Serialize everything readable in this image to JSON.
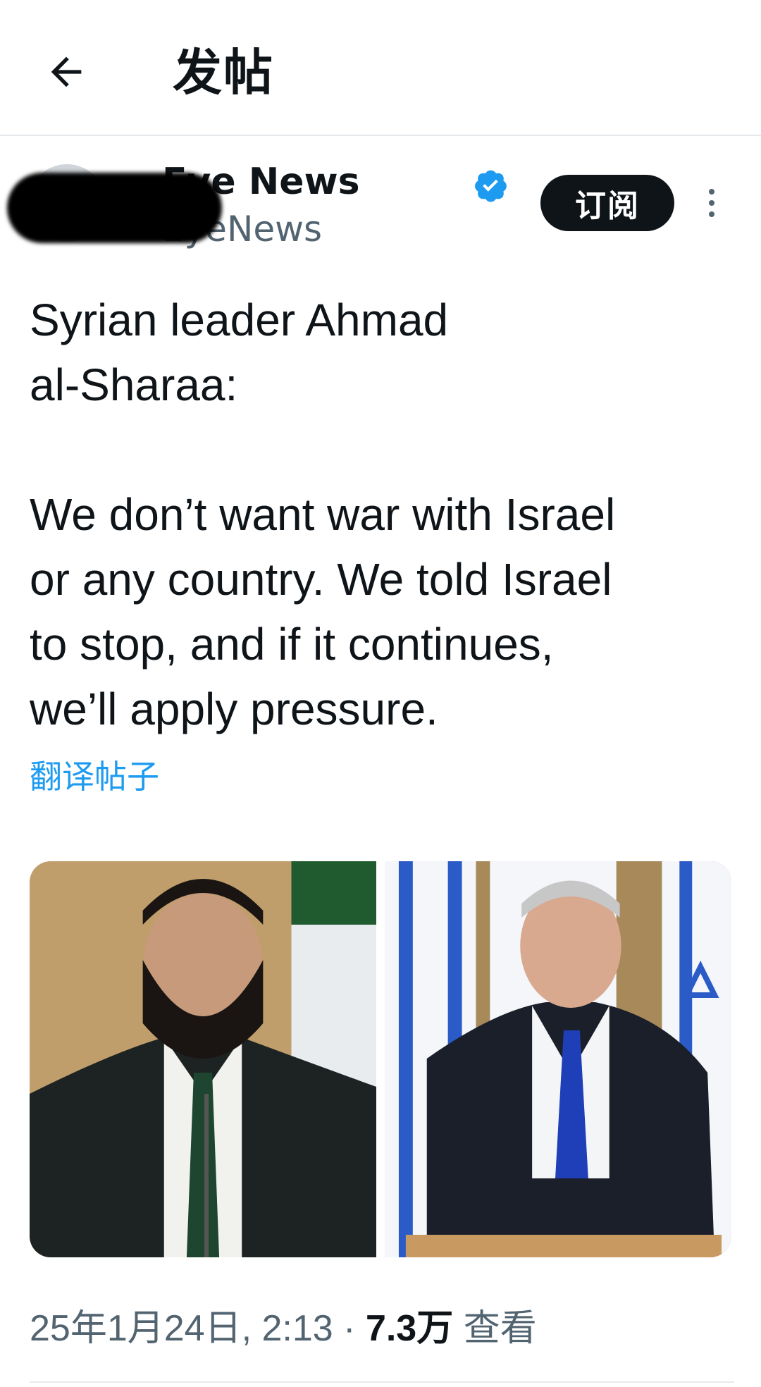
{
  "header": {
    "title": "发帖",
    "back_icon": "arrow-left-icon"
  },
  "author": {
    "name_visible": "Eye News",
    "handle_visible": "EyeNews",
    "verified": true,
    "subscribe_label": "订阅",
    "more_icon": "more-vertical-icon"
  },
  "post": {
    "text": "Syrian leader Ahmad\nal-Sharaa:\n\nWe don’t want war with Israel\nor any country. We told Israel\nto stop, and if it continues,\nwe’ll apply pressure.",
    "translate_label": "翻译帖子"
  },
  "media": {
    "count": 2
  },
  "meta": {
    "timestamp": "25年1月24日, 2:13",
    "separator": "·",
    "views": "7.3万",
    "views_label": "查看"
  },
  "colors": {
    "text_primary": "#0f1419",
    "text_secondary": "#536471",
    "link": "#1d9bf0",
    "verified": "#1d9bf0",
    "button_bg": "#0f1419"
  }
}
